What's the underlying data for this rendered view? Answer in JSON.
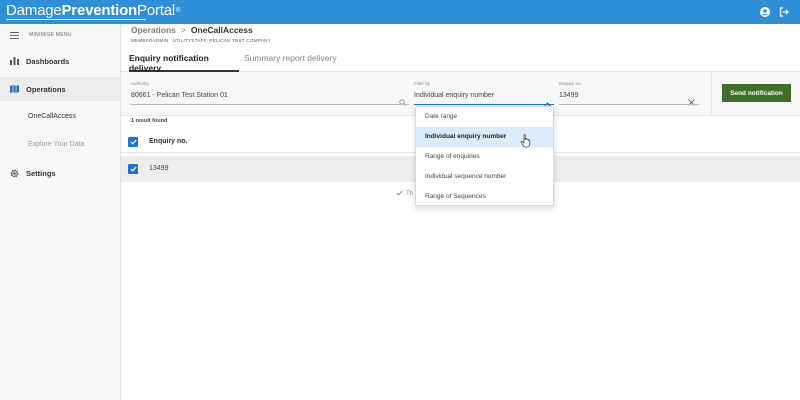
{
  "app": {
    "logo_light": "Damage",
    "logo_bold": "Prevention",
    "logo_portal": "Portal",
    "logo_mark": "®"
  },
  "topbar": {
    "icons": [
      "user-icon",
      "logout-icon"
    ]
  },
  "sidebar": {
    "minimize_label": "MINIMISE MENU",
    "items": [
      {
        "label": "Dashboards",
        "icon": "dashboard-icon"
      },
      {
        "label": "Operations",
        "icon": "map-icon"
      },
      {
        "label": "OneCallAccess"
      },
      {
        "label": "Explore Your Data"
      },
      {
        "label": "Settings",
        "icon": "gear-icon"
      }
    ]
  },
  "breadcrumb": {
    "parent": "Operations",
    "separator": ">",
    "current": "OneCallAccess",
    "sub_member": "MEMBERADMIN",
    "sub_company": "UTILITYSTAFF, PELICAN TEST COMPANY"
  },
  "tabs": [
    {
      "label": "Enquiry notification delivery",
      "active": true
    },
    {
      "label": "Summary report delivery",
      "active": false
    }
  ],
  "filters": {
    "authority_label": "Authority",
    "authority_value": "80661 - Pelican Test Station 01",
    "filterby_label": "Filter by",
    "filterby_value": "Individual enquiry number",
    "enquiry_label": "Enquiry no.",
    "enquiry_value": "13499"
  },
  "send_button": "Send notification",
  "results": {
    "count_text": "1 result found",
    "column_header": "Enquiry no.",
    "rows": [
      "13499"
    ]
  },
  "footer_note": "Th",
  "dropdown": {
    "options": [
      "Date range",
      "Individual enquiry number",
      "Range of enquiries",
      "Individual sequence number",
      "Range of Sequences"
    ],
    "selected": "Individual enquiry number"
  },
  "colors": {
    "topbar": "#2f8fd6",
    "accent_blue": "#1f73c8",
    "button_green": "#3f6f2a",
    "selected_option": "#dcebfa"
  }
}
